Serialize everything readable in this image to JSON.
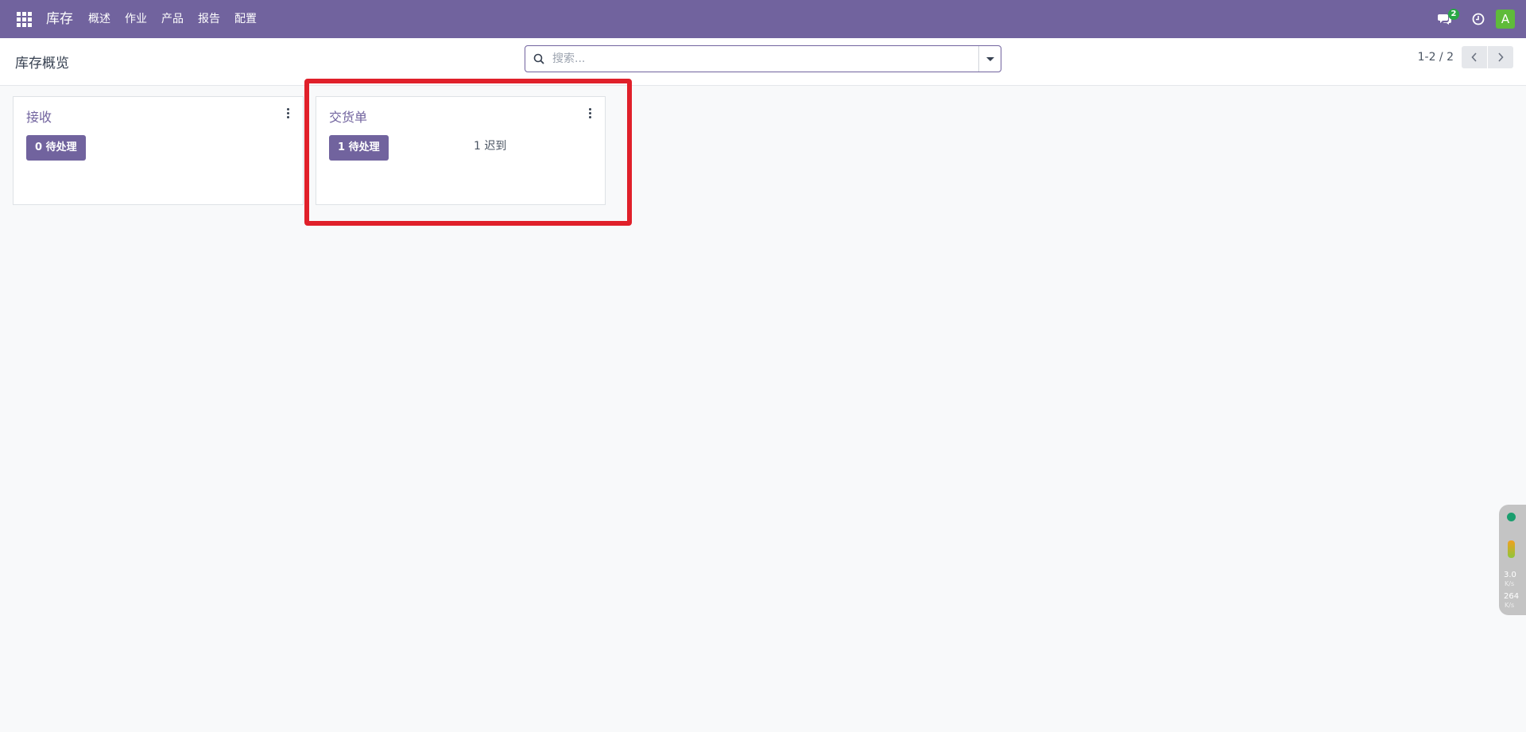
{
  "navbar": {
    "app_name": "库存",
    "menu": [
      "概述",
      "作业",
      "产品",
      "报告",
      "配置"
    ],
    "chat_count": "2",
    "avatar_letter": "A",
    "icons": [
      "apps-grid-icon",
      "chat-icon",
      "clock-icon"
    ]
  },
  "control_panel": {
    "title": "库存概览",
    "search_placeholder": "搜索...",
    "pager_value": "1-2 / 2"
  },
  "cards": [
    {
      "title": "接收",
      "button": "0 待处理",
      "late": ""
    },
    {
      "title": "交货单",
      "button": "1 待处理",
      "late": "1 迟到"
    }
  ],
  "widget": {
    "upload_rate": "3.0",
    "upload_unit": "K/s",
    "download_rate": "264",
    "download_unit": "K/s"
  },
  "colors": {
    "brand": "#71639e",
    "highlight": "#e0202a",
    "badge": "#28a745",
    "avatar": "#5fbb3a"
  }
}
